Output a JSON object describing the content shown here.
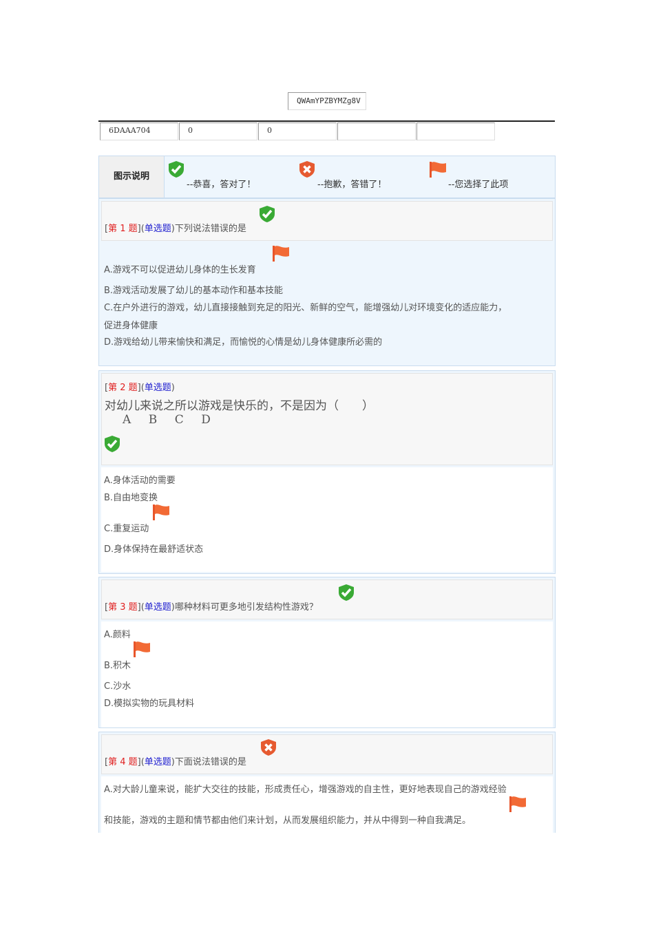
{
  "header": {
    "code": "QWAmYPZBYMZg8V",
    "cells": [
      "6DAAA704",
      "0",
      "0",
      "",
      ""
    ]
  },
  "legend": {
    "title": "图示说明",
    "correct": "--恭喜，答对了！",
    "wrong": "--抱歉，答错了！",
    "selected": "--您选择了此项"
  },
  "questions": [
    {
      "num_prefix": "[",
      "num": "第 1 题",
      "mid": "](",
      "type": "单选题",
      "close": ")",
      "text": "下列说法错误的是",
      "result": "correct",
      "options": [
        "A.游戏不可以促进幼儿身体的生长发育",
        "B.游戏活动发展了幼儿的基本动作和基本技能",
        "C.在户外进行的游戏，幼儿直接接触到充足的阳光、新鲜的空气，能增强幼儿对环境变化的适应能力，",
        "促进身体健康",
        "D.游戏给幼儿带来愉快和满足，而愉悦的心情是幼儿身体健康所必需的"
      ],
      "selected": "A"
    },
    {
      "num_prefix": "[",
      "num": "第 2 题",
      "mid": "](",
      "type": "单选题",
      "close": ")",
      "text": "对幼儿来说之所以游戏是快乐的，不是因为（　　）",
      "choices": [
        "A",
        "B",
        "C",
        "D"
      ],
      "result": "correct",
      "options": [
        "A.身体活动的需要",
        "B.自由地变换",
        "C.重复运动",
        "D.身体保持在最舒适状态"
      ],
      "selected": "C"
    },
    {
      "num_prefix": "[",
      "num": "第 3 题",
      "mid": "](",
      "type": "单选题",
      "close": ")",
      "text": "哪种材料可更多地引发结构性游戏？",
      "result": "correct",
      "options": [
        "A.颜料",
        "B.积木",
        "C.沙水",
        "D.模拟实物的玩具材料"
      ],
      "selected": "B"
    },
    {
      "num_prefix": "[",
      "num": "第 4 题",
      "mid": "](",
      "type": "单选题",
      "close": ")",
      "text": "下面说法错误的是",
      "result": "wrong",
      "options": [
        "A.对大龄儿童来说，能扩大交往的技能，形成责任心，增强游戏的自主性，更好地表现自己的游戏经验",
        "和技能，游戏的主题和情节都由他们来计划，从而发展组织能力，并从中得到一种自我满足。"
      ],
      "selected": "A"
    }
  ]
}
